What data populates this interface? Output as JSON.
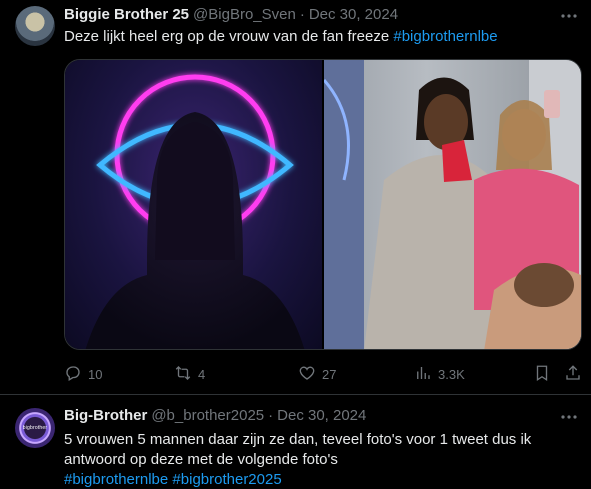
{
  "tweet1": {
    "author_name": "Biggie Brother 25",
    "handle": "@BigBro_Sven",
    "separator": "·",
    "date": "Dec 30, 2024",
    "text": "Deze lijkt heel erg op de vrouw van de fan freeze",
    "hashtag": "#bigbrothernlbe",
    "actions": {
      "replies": "10",
      "reposts": "4",
      "likes": "27",
      "views": "3.3K"
    }
  },
  "tweet2": {
    "author_name": "Big-Brother",
    "handle": "@b_brother2025",
    "separator": "·",
    "date": "Dec 30, 2024",
    "text_line1": "5 vrouwen 5 mannen daar zijn ze dan, teveel foto's voor 1 tweet dus ik",
    "text_line2": "antwoord op deze  met de volgende foto's",
    "hashtag1": "#bigbrothernlbe",
    "hashtag2": "#bigbrother2025",
    "avatar_text": "bigbrother"
  },
  "icons": {
    "more": "more-horizontal-icon",
    "reply": "reply-icon",
    "repost": "repost-icon",
    "like": "heart-icon",
    "views": "views-chart-icon",
    "bookmark": "bookmark-icon",
    "share": "share-icon"
  },
  "colors": {
    "background": "#000000",
    "text": "#e7e9ea",
    "muted": "#71767b",
    "link": "#1d9bf0",
    "divider": "#2f3336"
  }
}
